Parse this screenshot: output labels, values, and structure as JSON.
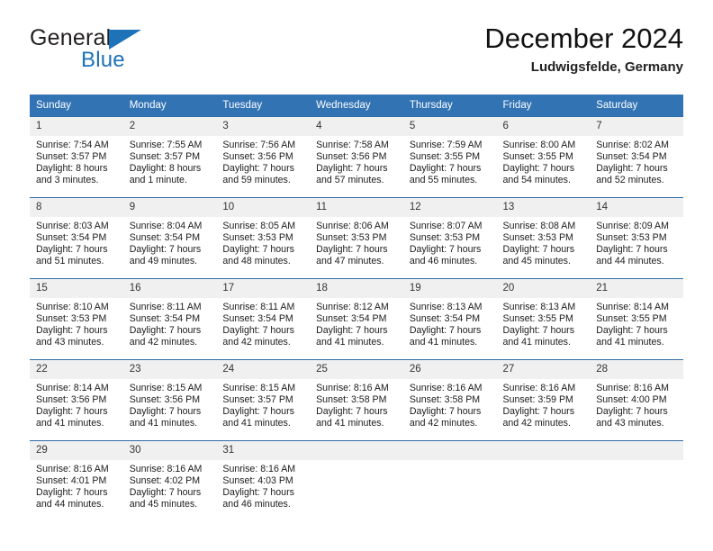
{
  "brand": {
    "name_top": "General",
    "name_bottom": "Blue",
    "triangle_color": "#1d72b8",
    "top_color": "#231f20"
  },
  "header": {
    "month_title": "December 2024",
    "location": "Ludwigsfelde, Germany"
  },
  "colors": {
    "header_row": "#3273b4",
    "grid_line": "#2e6da4",
    "daynum_background": "#f0f0f0"
  },
  "weekday_headers": [
    "Sunday",
    "Monday",
    "Tuesday",
    "Wednesday",
    "Thursday",
    "Friday",
    "Saturday"
  ],
  "labels": {
    "sunrise_prefix": "Sunrise:",
    "sunset_prefix": "Sunset:",
    "daylight_prefix": "Daylight:"
  },
  "weeks": [
    [
      {
        "day": "1",
        "sunrise": "Sunrise: 7:54 AM",
        "sunset": "Sunset: 3:57 PM",
        "daylight_line1": "Daylight: 8 hours",
        "daylight_line2": "and 3 minutes."
      },
      {
        "day": "2",
        "sunrise": "Sunrise: 7:55 AM",
        "sunset": "Sunset: 3:57 PM",
        "daylight_line1": "Daylight: 8 hours",
        "daylight_line2": "and 1 minute."
      },
      {
        "day": "3",
        "sunrise": "Sunrise: 7:56 AM",
        "sunset": "Sunset: 3:56 PM",
        "daylight_line1": "Daylight: 7 hours",
        "daylight_line2": "and 59 minutes."
      },
      {
        "day": "4",
        "sunrise": "Sunrise: 7:58 AM",
        "sunset": "Sunset: 3:56 PM",
        "daylight_line1": "Daylight: 7 hours",
        "daylight_line2": "and 57 minutes."
      },
      {
        "day": "5",
        "sunrise": "Sunrise: 7:59 AM",
        "sunset": "Sunset: 3:55 PM",
        "daylight_line1": "Daylight: 7 hours",
        "daylight_line2": "and 55 minutes."
      },
      {
        "day": "6",
        "sunrise": "Sunrise: 8:00 AM",
        "sunset": "Sunset: 3:55 PM",
        "daylight_line1": "Daylight: 7 hours",
        "daylight_line2": "and 54 minutes."
      },
      {
        "day": "7",
        "sunrise": "Sunrise: 8:02 AM",
        "sunset": "Sunset: 3:54 PM",
        "daylight_line1": "Daylight: 7 hours",
        "daylight_line2": "and 52 minutes."
      }
    ],
    [
      {
        "day": "8",
        "sunrise": "Sunrise: 8:03 AM",
        "sunset": "Sunset: 3:54 PM",
        "daylight_line1": "Daylight: 7 hours",
        "daylight_line2": "and 51 minutes."
      },
      {
        "day": "9",
        "sunrise": "Sunrise: 8:04 AM",
        "sunset": "Sunset: 3:54 PM",
        "daylight_line1": "Daylight: 7 hours",
        "daylight_line2": "and 49 minutes."
      },
      {
        "day": "10",
        "sunrise": "Sunrise: 8:05 AM",
        "sunset": "Sunset: 3:53 PM",
        "daylight_line1": "Daylight: 7 hours",
        "daylight_line2": "and 48 minutes."
      },
      {
        "day": "11",
        "sunrise": "Sunrise: 8:06 AM",
        "sunset": "Sunset: 3:53 PM",
        "daylight_line1": "Daylight: 7 hours",
        "daylight_line2": "and 47 minutes."
      },
      {
        "day": "12",
        "sunrise": "Sunrise: 8:07 AM",
        "sunset": "Sunset: 3:53 PM",
        "daylight_line1": "Daylight: 7 hours",
        "daylight_line2": "and 46 minutes."
      },
      {
        "day": "13",
        "sunrise": "Sunrise: 8:08 AM",
        "sunset": "Sunset: 3:53 PM",
        "daylight_line1": "Daylight: 7 hours",
        "daylight_line2": "and 45 minutes."
      },
      {
        "day": "14",
        "sunrise": "Sunrise: 8:09 AM",
        "sunset": "Sunset: 3:53 PM",
        "daylight_line1": "Daylight: 7 hours",
        "daylight_line2": "and 44 minutes."
      }
    ],
    [
      {
        "day": "15",
        "sunrise": "Sunrise: 8:10 AM",
        "sunset": "Sunset: 3:53 PM",
        "daylight_line1": "Daylight: 7 hours",
        "daylight_line2": "and 43 minutes."
      },
      {
        "day": "16",
        "sunrise": "Sunrise: 8:11 AM",
        "sunset": "Sunset: 3:54 PM",
        "daylight_line1": "Daylight: 7 hours",
        "daylight_line2": "and 42 minutes."
      },
      {
        "day": "17",
        "sunrise": "Sunrise: 8:11 AM",
        "sunset": "Sunset: 3:54 PM",
        "daylight_line1": "Daylight: 7 hours",
        "daylight_line2": "and 42 minutes."
      },
      {
        "day": "18",
        "sunrise": "Sunrise: 8:12 AM",
        "sunset": "Sunset: 3:54 PM",
        "daylight_line1": "Daylight: 7 hours",
        "daylight_line2": "and 41 minutes."
      },
      {
        "day": "19",
        "sunrise": "Sunrise: 8:13 AM",
        "sunset": "Sunset: 3:54 PM",
        "daylight_line1": "Daylight: 7 hours",
        "daylight_line2": "and 41 minutes."
      },
      {
        "day": "20",
        "sunrise": "Sunrise: 8:13 AM",
        "sunset": "Sunset: 3:55 PM",
        "daylight_line1": "Daylight: 7 hours",
        "daylight_line2": "and 41 minutes."
      },
      {
        "day": "21",
        "sunrise": "Sunrise: 8:14 AM",
        "sunset": "Sunset: 3:55 PM",
        "daylight_line1": "Daylight: 7 hours",
        "daylight_line2": "and 41 minutes."
      }
    ],
    [
      {
        "day": "22",
        "sunrise": "Sunrise: 8:14 AM",
        "sunset": "Sunset: 3:56 PM",
        "daylight_line1": "Daylight: 7 hours",
        "daylight_line2": "and 41 minutes."
      },
      {
        "day": "23",
        "sunrise": "Sunrise: 8:15 AM",
        "sunset": "Sunset: 3:56 PM",
        "daylight_line1": "Daylight: 7 hours",
        "daylight_line2": "and 41 minutes."
      },
      {
        "day": "24",
        "sunrise": "Sunrise: 8:15 AM",
        "sunset": "Sunset: 3:57 PM",
        "daylight_line1": "Daylight: 7 hours",
        "daylight_line2": "and 41 minutes."
      },
      {
        "day": "25",
        "sunrise": "Sunrise: 8:16 AM",
        "sunset": "Sunset: 3:58 PM",
        "daylight_line1": "Daylight: 7 hours",
        "daylight_line2": "and 41 minutes."
      },
      {
        "day": "26",
        "sunrise": "Sunrise: 8:16 AM",
        "sunset": "Sunset: 3:58 PM",
        "daylight_line1": "Daylight: 7 hours",
        "daylight_line2": "and 42 minutes."
      },
      {
        "day": "27",
        "sunrise": "Sunrise: 8:16 AM",
        "sunset": "Sunset: 3:59 PM",
        "daylight_line1": "Daylight: 7 hours",
        "daylight_line2": "and 42 minutes."
      },
      {
        "day": "28",
        "sunrise": "Sunrise: 8:16 AM",
        "sunset": "Sunset: 4:00 PM",
        "daylight_line1": "Daylight: 7 hours",
        "daylight_line2": "and 43 minutes."
      }
    ],
    [
      {
        "day": "29",
        "sunrise": "Sunrise: 8:16 AM",
        "sunset": "Sunset: 4:01 PM",
        "daylight_line1": "Daylight: 7 hours",
        "daylight_line2": "and 44 minutes."
      },
      {
        "day": "30",
        "sunrise": "Sunrise: 8:16 AM",
        "sunset": "Sunset: 4:02 PM",
        "daylight_line1": "Daylight: 7 hours",
        "daylight_line2": "and 45 minutes."
      },
      {
        "day": "31",
        "sunrise": "Sunrise: 8:16 AM",
        "sunset": "Sunset: 4:03 PM",
        "daylight_line1": "Daylight: 7 hours",
        "daylight_line2": "and 46 minutes."
      },
      {
        "day": "",
        "sunrise": "",
        "sunset": "",
        "daylight_line1": "",
        "daylight_line2": ""
      },
      {
        "day": "",
        "sunrise": "",
        "sunset": "",
        "daylight_line1": "",
        "daylight_line2": ""
      },
      {
        "day": "",
        "sunrise": "",
        "sunset": "",
        "daylight_line1": "",
        "daylight_line2": ""
      },
      {
        "day": "",
        "sunrise": "",
        "sunset": "",
        "daylight_line1": "",
        "daylight_line2": ""
      }
    ]
  ]
}
